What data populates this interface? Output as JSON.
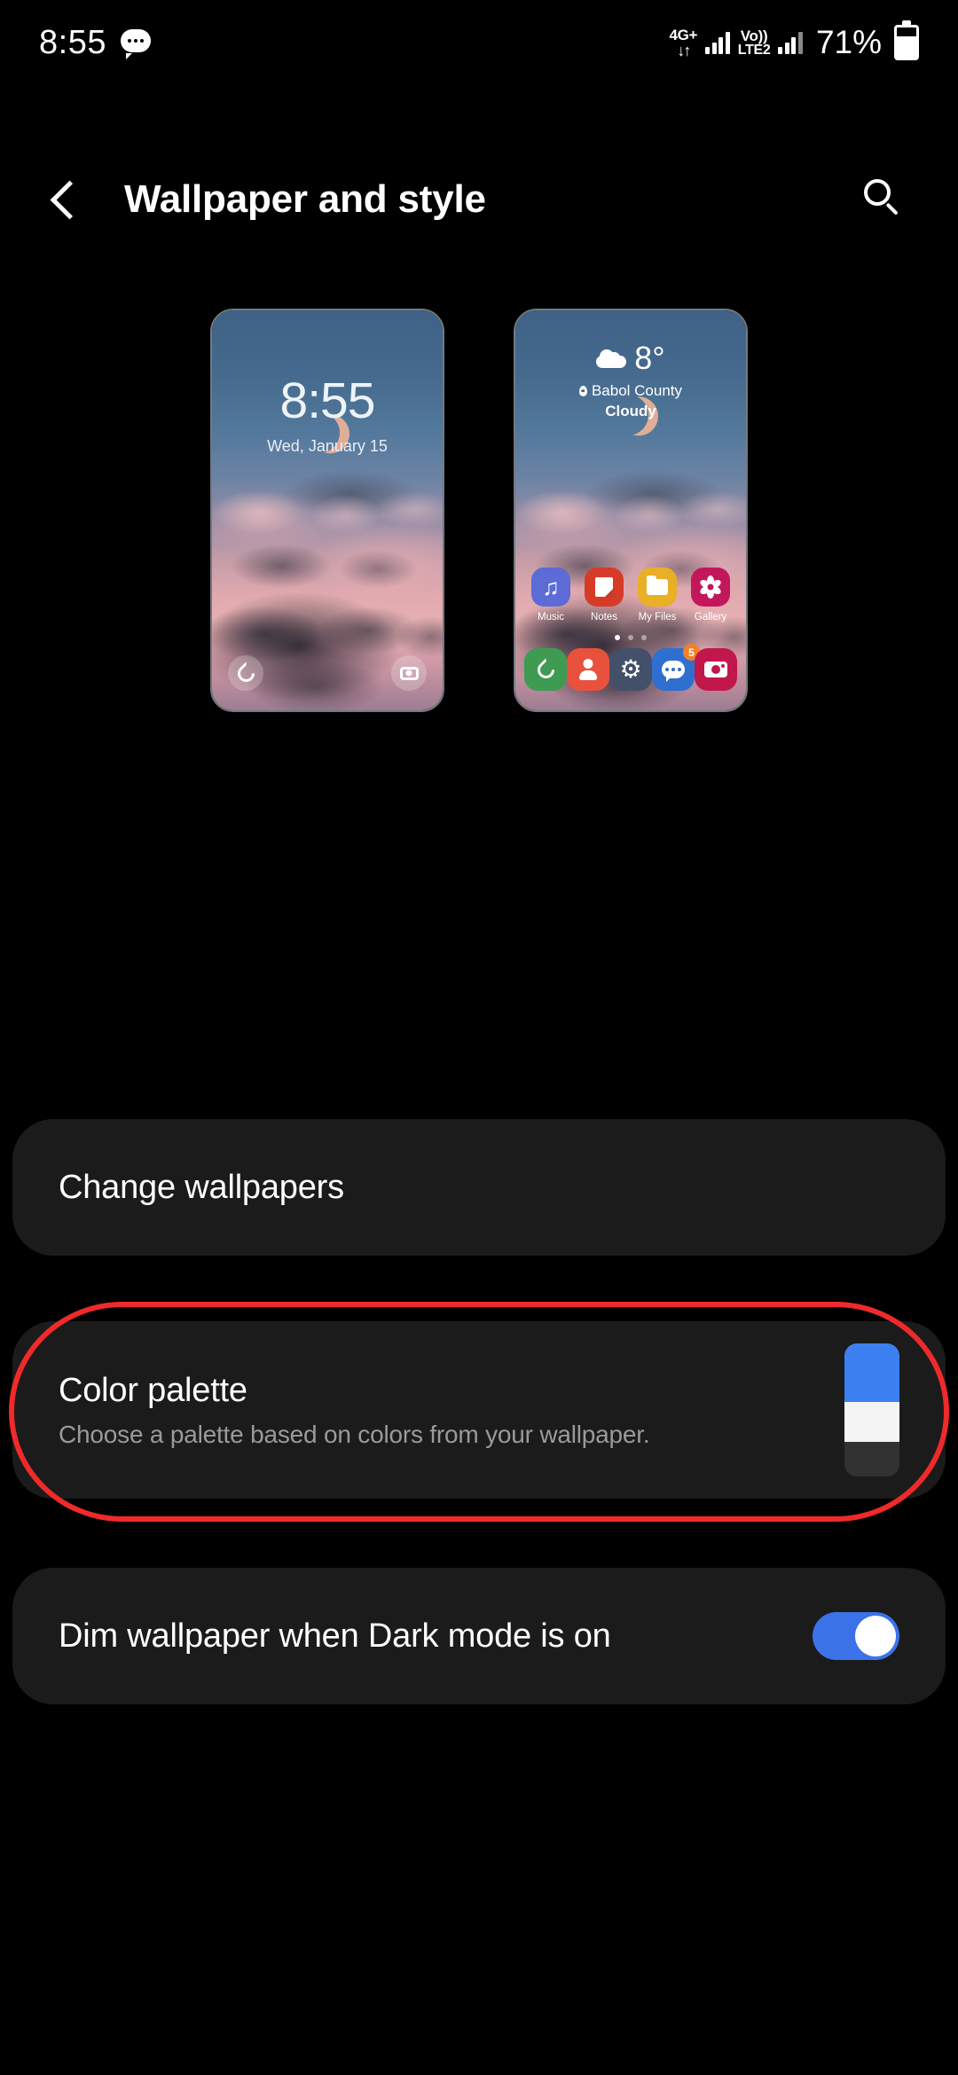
{
  "status_bar": {
    "time": "8:55",
    "message_icon": "message-bubble-icon",
    "network_label_top": "4G+",
    "network_arrows": "↓↑",
    "volte_top": "Vo))",
    "volte_bottom": "LTE2",
    "battery_percent": "71%",
    "battery_icon": "battery-icon"
  },
  "app_bar": {
    "back_icon": "back-chevron-icon",
    "title": "Wallpaper and style",
    "search_icon": "search-icon"
  },
  "previews": {
    "lock_screen": {
      "name": "Lock screen preview",
      "clock": "8:55",
      "date": "Wed, January 15",
      "shortcut_left_icon": "phone-icon",
      "shortcut_right_icon": "camera-icon"
    },
    "home_screen": {
      "name": "Home screen preview",
      "weather": {
        "icon": "cloudy-icon",
        "temperature": "8°",
        "location_pin_icon": "location-pin-icon",
        "location": "Babol County",
        "condition": "Cloudy"
      },
      "apps": [
        {
          "label": "Music",
          "icon": "music-app-icon",
          "color": "#5c6bd6",
          "glyph": "♪"
        },
        {
          "label": "Notes",
          "icon": "notes-app-icon",
          "color": "#d63b28",
          "glyph": ""
        },
        {
          "label": "My Files",
          "icon": "my-files-app-icon",
          "color": "#e9af26",
          "glyph": ""
        },
        {
          "label": "Gallery",
          "icon": "gallery-app-icon",
          "color": "#c2185b",
          "glyph": ""
        }
      ],
      "page_dots": {
        "count": 3,
        "active_index": 0
      },
      "dock": [
        {
          "label": "Phone",
          "icon": "phone-app-icon",
          "color": "#3f9b52",
          "badge": ""
        },
        {
          "label": "Contacts",
          "icon": "contacts-app-icon",
          "color": "#e8523c",
          "badge": ""
        },
        {
          "label": "Settings",
          "icon": "settings-app-icon",
          "color": "#44506a",
          "badge": ""
        },
        {
          "label": "Messages",
          "icon": "messages-app-icon",
          "color": "#2f6fd0",
          "badge": "5"
        },
        {
          "label": "Camera",
          "icon": "camera-app-icon",
          "color": "#c2174b",
          "badge": ""
        }
      ]
    }
  },
  "settings": {
    "change_wallpapers": {
      "title": "Change wallpapers"
    },
    "color_palette": {
      "title": "Color palette",
      "subtitle": "Choose a palette based on colors from your wallpaper.",
      "swatch_colors": [
        "#3b7ff0",
        "#f4f4f4",
        "#323232"
      ],
      "highlighted": true
    },
    "dim_wallpaper": {
      "title": "Dim wallpaper when Dark mode is on",
      "toggle_state": "on"
    }
  },
  "colors": {
    "background": "#000000",
    "card": "#1b1b1b",
    "accent": "#3b72e8",
    "subtitle": "#9a9a9a",
    "annotation": "#ef2a2a"
  }
}
